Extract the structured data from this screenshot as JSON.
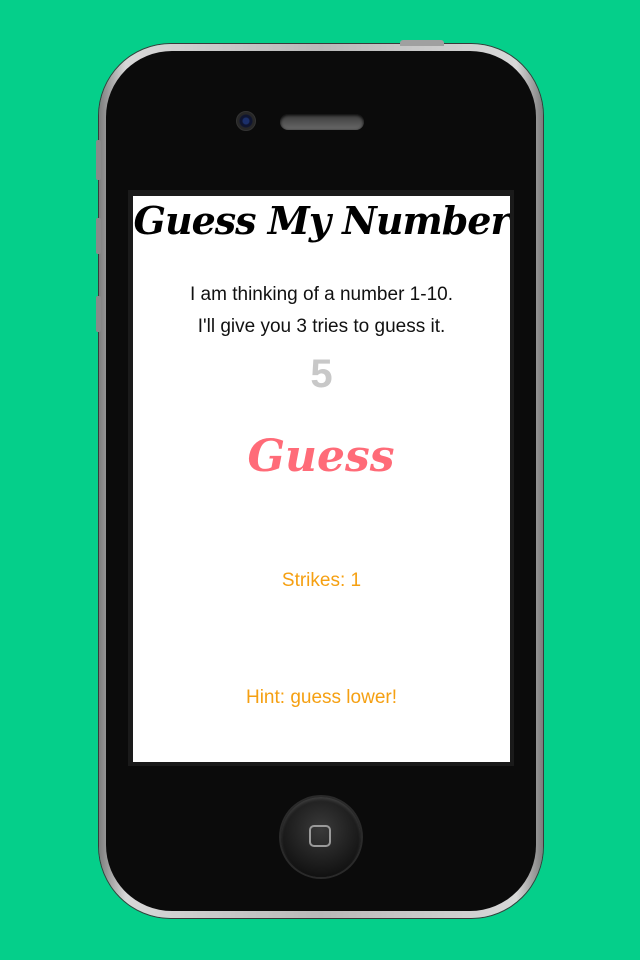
{
  "app": {
    "title": "Guess My Number",
    "description_line1": "I am thinking of a number 1-10.",
    "description_line2": "I'll give you 3 tries to guess it.",
    "current_number": "5",
    "guess_label": "Guess",
    "strikes_text": "Strikes: 1",
    "hint_text": "Hint: guess lower!"
  },
  "colors": {
    "background": "#05cf8a",
    "guess": "#ff6b78",
    "status": "#f5a012",
    "number": "#c8c8c8"
  },
  "icons": {
    "home_button": "home-button-icon",
    "camera": "camera-icon",
    "speaker": "speaker-icon"
  }
}
